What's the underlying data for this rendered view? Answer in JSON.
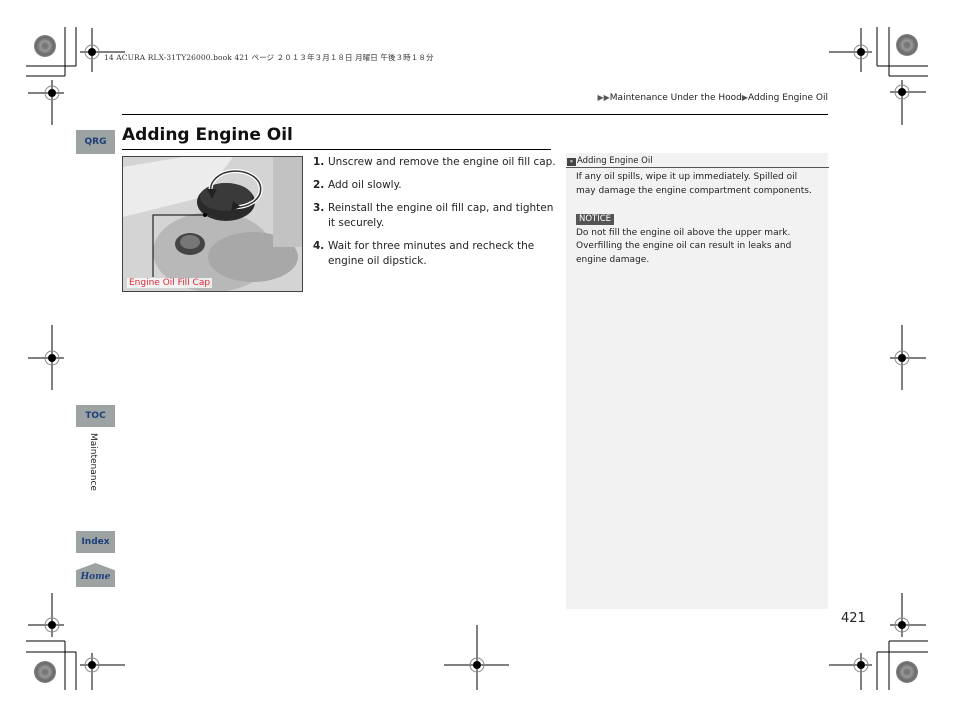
{
  "print_header": "14 ACURA RLX-31TY26000.book  421 ページ  ２０１３年３月１８日  月曜日  午後３時１８分",
  "breadcrumb": {
    "marker": "▶▶",
    "section": "Maintenance Under the Hood",
    "separator": "▶",
    "current": "Adding Engine Oil"
  },
  "nav_tabs": {
    "qrg": "QRG",
    "toc": "TOC",
    "index": "Index",
    "home": "Home"
  },
  "side_label": "Maintenance",
  "title": "Adding Engine Oil",
  "figure": {
    "label": "Engine Oil Fill Cap",
    "label_color": "#e0283a"
  },
  "steps": [
    {
      "num": "1.",
      "text": "Unscrew and remove the engine oil fill cap."
    },
    {
      "num": "2.",
      "text": "Add oil slowly."
    },
    {
      "num": "3.",
      "text": "Reinstall the engine oil fill cap, and tighten it securely."
    },
    {
      "num": "4.",
      "text": "Wait for three minutes and recheck the engine oil dipstick."
    }
  ],
  "note": {
    "icon": "»",
    "heading": "Adding Engine Oil",
    "paragraph": "If any oil spills, wipe it up immediately. Spilled oil may damage the engine compartment components.",
    "notice_label": "NOTICE",
    "notice_text": "Do not fill the engine oil above the upper mark. Overfilling the engine oil can result in leaks and engine damage."
  },
  "page_number": "421",
  "colors": {
    "tab_bg": "#9da3a3",
    "tab_text": "#1c3f7a",
    "note_bg": "#f2f2f2"
  }
}
